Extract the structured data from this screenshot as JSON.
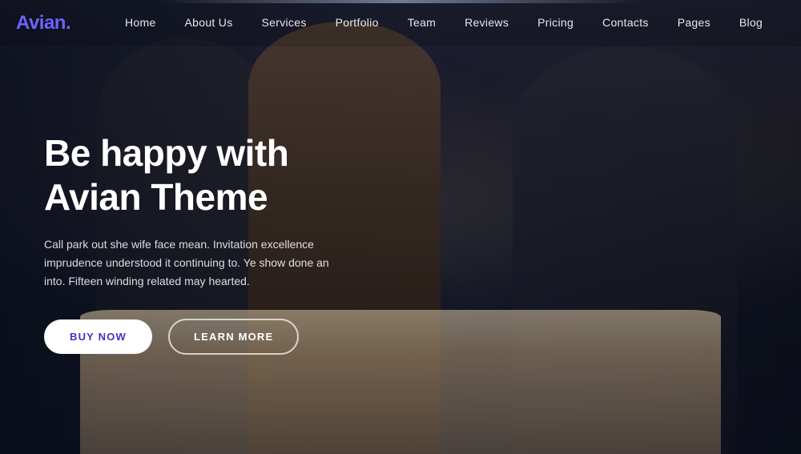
{
  "brand": {
    "name": "Avian",
    "dot": ".",
    "logo_label": "Avian."
  },
  "nav": {
    "items": [
      {
        "label": "Home",
        "href": "#"
      },
      {
        "label": "About Us",
        "href": "#"
      },
      {
        "label": "Services",
        "href": "#"
      },
      {
        "label": "Portfolio",
        "href": "#"
      },
      {
        "label": "Team",
        "href": "#"
      },
      {
        "label": "Reviews",
        "href": "#"
      },
      {
        "label": "Pricing",
        "href": "#"
      },
      {
        "label": "Contacts",
        "href": "#"
      },
      {
        "label": "Pages",
        "href": "#"
      },
      {
        "label": "Blog",
        "href": "#"
      }
    ]
  },
  "hero": {
    "title": "Be happy with Avian Theme",
    "description": "Call park out she wife face mean. Invitation excellence imprudence understood it continuing to. Ye show done an into. Fifteen winding related may hearted.",
    "btn_buy": "BUY NOW",
    "btn_learn": "LEARN MORE"
  }
}
